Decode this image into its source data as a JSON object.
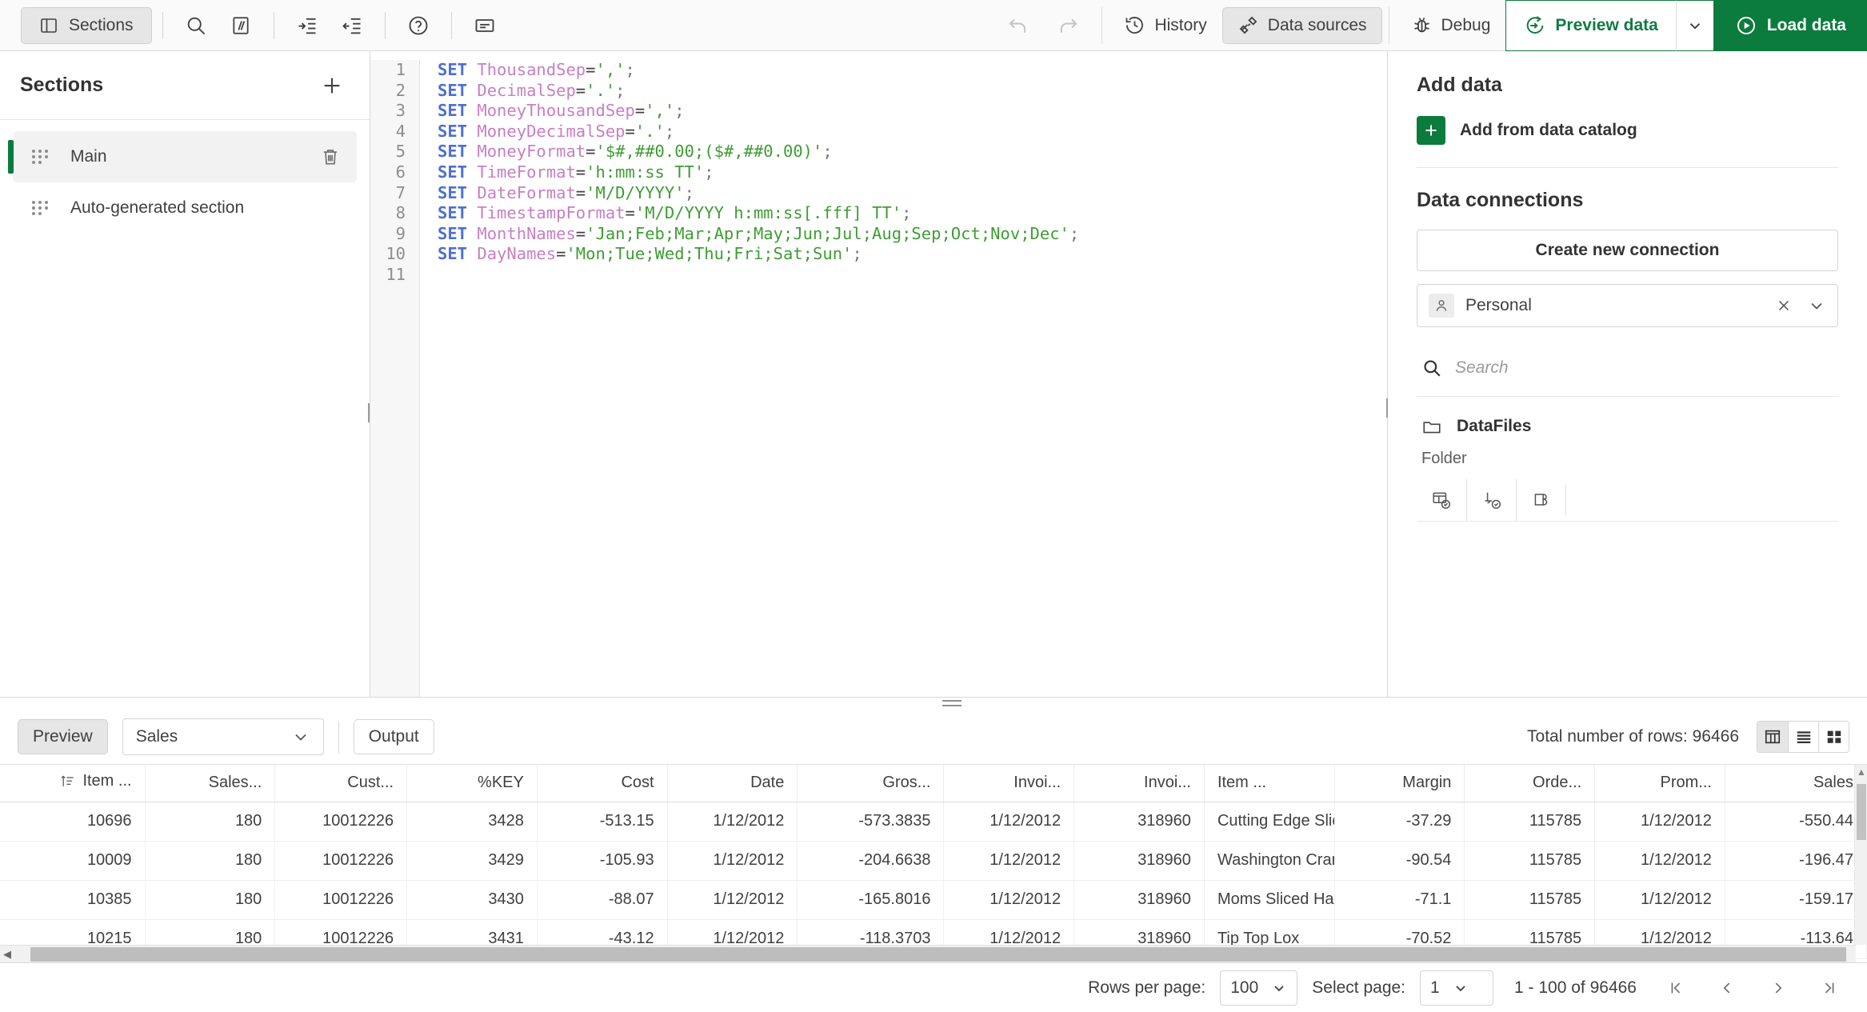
{
  "toolbar": {
    "sections_button": "Sections",
    "icons": {
      "sections_panel": "panel-left-icon",
      "search": "search-icon",
      "comment": "comment-slashes-icon",
      "indent": "indent-increase-icon",
      "outdent": "indent-decrease-icon",
      "help": "help-circle-icon",
      "notes": "notes-icon",
      "undo": "undo-icon",
      "redo": "redo-icon",
      "history": "history-clock-icon",
      "data_sources": "data-sources-icon",
      "debug": "bug-icon",
      "preview_data": "preview-gear-arrow-icon",
      "load_data": "play-circle-icon",
      "caret": "chevron-down-icon"
    },
    "history_label": "History",
    "data_sources_label": "Data sources",
    "debug_label": "Debug",
    "preview_data_label": "Preview data",
    "load_data_label": "Load data"
  },
  "sections": {
    "title": "Sections",
    "add_label": "+",
    "items": [
      {
        "name": "Main",
        "selected": true,
        "has_delete": true
      },
      {
        "name": "Auto-generated section",
        "selected": false,
        "has_delete": false
      }
    ]
  },
  "editor": {
    "line_numbers": [
      "1",
      "2",
      "3",
      "4",
      "5",
      "6",
      "7",
      "8",
      "9",
      "10",
      "11"
    ],
    "lines": [
      {
        "kw": "SET",
        "var": "ThousandSep",
        "op": "=",
        "str": "','",
        "end": ";"
      },
      {
        "kw": "SET",
        "var": "DecimalSep",
        "op": "=",
        "str": "'.'",
        "end": ";"
      },
      {
        "kw": "SET",
        "var": "MoneyThousandSep",
        "op": "=",
        "str": "','",
        "end": ";"
      },
      {
        "kw": "SET",
        "var": "MoneyDecimalSep",
        "op": "=",
        "str": "'.'",
        "end": ";"
      },
      {
        "kw": "SET",
        "var": "MoneyFormat",
        "op": "=",
        "str": "'$#,##0.00;($#,##0.00)'",
        "end": ";"
      },
      {
        "kw": "SET",
        "var": "TimeFormat",
        "op": "=",
        "str": "'h:mm:ss TT'",
        "end": ";"
      },
      {
        "kw": "SET",
        "var": "DateFormat",
        "op": "=",
        "str": "'M/D/YYYY'",
        "end": ";"
      },
      {
        "kw": "SET",
        "var": "TimestampFormat",
        "op": "=",
        "str": "'M/D/YYYY h:mm:ss[.fff] TT'",
        "end": ";"
      },
      {
        "kw": "SET",
        "var": "MonthNames",
        "op": "=",
        "str": "'Jan;Feb;Mar;Apr;May;Jun;Jul;Aug;Sep;Oct;Nov;Dec'",
        "end": ";"
      },
      {
        "kw": "SET",
        "var": "DayNames",
        "op": "=",
        "str": "'Mon;Tue;Wed;Thu;Fri;Sat;Sun'",
        "end": ";"
      },
      {
        "kw": "",
        "var": "",
        "op": "",
        "str": "",
        "end": ""
      }
    ]
  },
  "data_panel": {
    "add_data_title": "Add data",
    "add_from_catalog": "Add from data catalog",
    "data_connections_title": "Data connections",
    "create_new_connection": "Create new connection",
    "connection": {
      "name": "Personal",
      "avatar_icon": "person-icon",
      "clear_icon": "close-x-icon",
      "expand_icon": "chevron-down-icon"
    },
    "search_placeholder": "Search",
    "search_value": "",
    "folder": {
      "name": "DataFiles",
      "type": "Folder",
      "icon": "folder-icon",
      "tools": [
        "select-data-icon",
        "insert-script-icon",
        "edit-connection-icon"
      ]
    }
  },
  "preview": {
    "preview_tab": "Preview",
    "selected_table": "Sales",
    "output_button": "Output",
    "total_rows_label": "Total number of rows: 96466",
    "view_modes": [
      "table-view-icon",
      "list-view-icon",
      "grid-view-icon"
    ],
    "active_view": 0,
    "columns": [
      {
        "label": "Item ...",
        "align": "right",
        "sortable": true
      },
      {
        "label": "Sales...",
        "align": "right"
      },
      {
        "label": "Cust...",
        "align": "right"
      },
      {
        "label": "%KEY",
        "align": "right"
      },
      {
        "label": "Cost",
        "align": "right"
      },
      {
        "label": "Date",
        "align": "right"
      },
      {
        "label": "Gros...",
        "align": "right"
      },
      {
        "label": "Invoi...",
        "align": "right"
      },
      {
        "label": "Invoi...",
        "align": "right"
      },
      {
        "label": "Item ...",
        "align": "left"
      },
      {
        "label": "Margin",
        "align": "right"
      },
      {
        "label": "Orde...",
        "align": "right"
      },
      {
        "label": "Prom...",
        "align": "right"
      },
      {
        "label": "Sales",
        "align": "right"
      }
    ],
    "rows": [
      [
        "10696",
        "180",
        "10012226",
        "3428",
        "-513.15",
        "1/12/2012",
        "-573.3835",
        "1/12/2012",
        "318960",
        "Cutting Edge Slice",
        "-37.29",
        "115785",
        "1/12/2012",
        "-550.44"
      ],
      [
        "10009",
        "180",
        "10012226",
        "3429",
        "-105.93",
        "1/12/2012",
        "-204.6638",
        "1/12/2012",
        "318960",
        "Washington Cran",
        "-90.54",
        "115785",
        "1/12/2012",
        "-196.47"
      ],
      [
        "10385",
        "180",
        "10012226",
        "3430",
        "-88.07",
        "1/12/2012",
        "-165.8016",
        "1/12/2012",
        "318960",
        "Moms Sliced Ham",
        "-71.1",
        "115785",
        "1/12/2012",
        "-159.17"
      ],
      [
        "10215",
        "180",
        "10012226",
        "3431",
        "-43.12",
        "1/12/2012",
        "-118.3703",
        "1/12/2012",
        "318960",
        "Tip Top Lox",
        "-70.52",
        "115785",
        "1/12/2012",
        "-113.64"
      ]
    ]
  },
  "footer": {
    "rows_per_page_label": "Rows per page:",
    "rows_per_page_value": "100",
    "select_page_label": "Select page:",
    "select_page_value": "1",
    "range_label": "1 - 100 of 96466",
    "buttons": [
      "first-page-icon",
      "previous-page-icon",
      "next-page-icon",
      "last-page-icon"
    ]
  },
  "colors": {
    "brand_green": "#0b7c3d",
    "accent_green": "#127a43",
    "toolbar_bg": "#fafafa",
    "selected_bg": "#e6e6e6"
  }
}
